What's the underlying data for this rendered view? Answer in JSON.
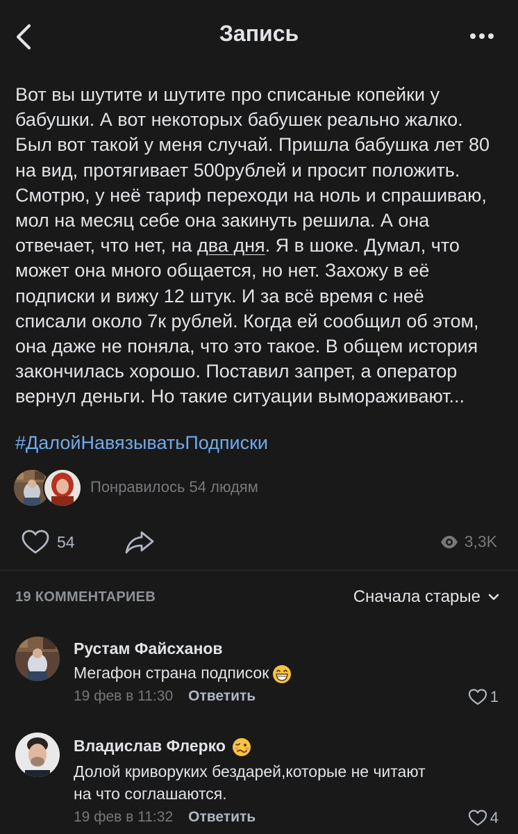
{
  "header": {
    "title": "Запись",
    "back_icon": "chevron-left-icon",
    "more_icon": "more-horizontal-icon"
  },
  "post": {
    "text_part1": "Вот вы шутите и шутите про списаные копейки у\nбабушки. А вот некоторых бабушек реально жалко.\nБыл вот такой у меня случай. Пришла бабушка лет 80\nна вид, протягивает 500рублей и просит положить.\nСмотрю, у неё тариф переходи на ноль и спрашиваю,\nмол на месяц себе она закинуть решила. А она\nотвечает, что нет, на ",
    "text_underlined": "два дня",
    "text_part2": ". Я в шоке. Думал, что\nможет она много общается, но нет. Захожу в её\nподписки и вижу 12 штук. И за всё время с неё\nсписали около 7к рублей. Когда ей сообщил об этом,\nона даже не поняла, что это такое. В общем история\nзакончилась хорошо. Поставил запрет, а оператор\nвернул деньги. Но такие ситуации выморaживают...",
    "hashtag": "#ДалойНавязыватьПодписки",
    "liked_by_text": "Понравилось 54 людям",
    "likes_count": "54",
    "views_count": "3,3K"
  },
  "comments_section": {
    "count_label": "19 КОММЕНТАРИЕВ",
    "sort_label": "Сначала старые"
  },
  "comments": [
    {
      "author": "Рустам Файсханов",
      "text": "Мегафон страна подписок",
      "emoji": "grinning-face-emoji",
      "date": "19 фев в 11:30",
      "reply_label": "Ответить",
      "likes": "1"
    },
    {
      "author": "Владислав Флерко",
      "author_emoji": "woozy-face-emoji",
      "text": "Долой криворуких бездарей,которые не читают\nна что соглашаются.",
      "date": "19 фев в 11:32",
      "reply_label": "Ответить",
      "likes": "4"
    }
  ],
  "colors": {
    "background": "#19191a",
    "text": "#e1e3e6",
    "secondary": "#76787a",
    "link": "#71aaeb",
    "divider": "#2f2f31"
  }
}
